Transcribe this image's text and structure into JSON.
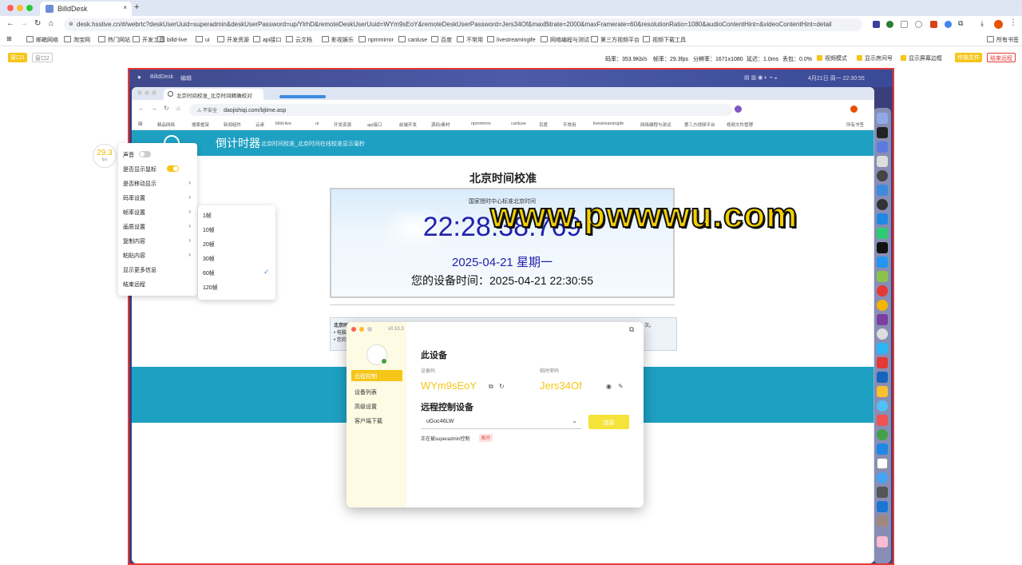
{
  "outer_browser": {
    "tab_title": "BilldDesk",
    "new_tab": "+",
    "url": "desk.hsslive.cn/#/webrtc?deskUserUuid=superadmin&deskUserPassword=up/YlrhD&remoteDeskUserUuid=WYm9sEoY&remoteDeskUserPassword=Jers34Of&maxBitrate=2000&maxFramerate=60&resolutionRatio=1080&audioContentHint=&videoContentHint=detail",
    "bookmarks": [
      "应用",
      "邮箱网络",
      "淘宝网",
      "热门网站",
      "开发工具",
      "billd-live",
      "ui",
      "开发资源",
      "api接口",
      "云文档",
      "影视娱乐",
      "npmmirror",
      "canluse",
      "百度",
      "不常用",
      "livestreamingife",
      "网络编程与测试",
      "第三方视频平台",
      "视频下载工具"
    ],
    "bookmarks_right": "所有书签"
  },
  "control_bar": {
    "btn_window1": "窗口1",
    "btn_window2": "窗口2",
    "stats": [
      "码率：353.9Kb/s",
      "帧率：29.3fps",
      "分辨率：1671x1080",
      "延迟：1.0ms",
      "丢包：0.0%"
    ],
    "options": [
      "视频模式",
      "显示房间号",
      "显示屏幕边框"
    ],
    "btn_file": "传输文件",
    "btn_end": "结束远程"
  },
  "remote": {
    "mac_menu": [
      "BilldDesk",
      "编辑"
    ],
    "mac_status_time": "4月21日 周一 22:30:55",
    "inner_tab": "北京时间校准_北京时间精确校对",
    "inner_url": "daojishiqi.com/bjtime.asp",
    "inner_insecure": "不安全",
    "inner_bookmarks": [
      "精品网络",
      "搜索框架",
      "新闻组件",
      "云桌",
      "billd-live",
      "ui",
      "开发资源",
      "api接口",
      "前端开发",
      "源码/素材",
      "npmmirror",
      "canluse",
      "百度",
      "不常用",
      "livestreamingife",
      "网络编程与测试",
      "第三方视频平台",
      "视频文件管理"
    ],
    "inner_bookmarks_right": "所有书签",
    "site_title": "倒计时器",
    "site_subtitle": "北京时间校准_北京时间在线校准显示毫秒",
    "page_heading": "北京时间校准",
    "clock_label": "国家授时中心标准北京时间",
    "clock_time": "22:28:38.769",
    "clock_date": "2025-04-21 星期一",
    "device_time": "您的设备时间：2025-04-21 22:30:55",
    "info_line1": "北京时间",
    "info_line1_right": "次。",
    "info_bullet1": "• 电脑时",
    "info_bullet2": "• 您的时"
  },
  "fps_badge": {
    "value": "29.3",
    "unit": "fps"
  },
  "menu": {
    "sound": "声音",
    "show_cursor": "是否显示鼠标",
    "video_mode": "是否移动显示",
    "bitrate": "码率设置",
    "framerate": "帧率设置",
    "resolution": "画质设置",
    "copy_content": "复制内容",
    "paste_content": "粘贴内容",
    "show_more": "显示更多信息",
    "end_remote": "结束远程"
  },
  "fps_options": [
    "1帧",
    "10帧",
    "20帧",
    "30帧",
    "60帧",
    "120帧"
  ],
  "fps_selected_index": 4,
  "watermark": "www.pwwwu.com",
  "app": {
    "version": "v0.10.3",
    "nav": [
      "远程控制",
      "设备列表",
      "高级设置",
      "客户端下载"
    ],
    "section_this": "此设备",
    "label_device_id": "设备码",
    "device_id": "WYm9sEoY",
    "label_temp_pw": "临时密码",
    "temp_pw": "Jers34Of",
    "section_remote": "远程控制设备",
    "remote_id": "uGuc46LW",
    "connect_btn": "连接",
    "controlled_by": "正在被superadmin控制",
    "disconnect_badge": "断开"
  },
  "colors": {
    "accent": "#f5c518",
    "header": "#1ea0c3",
    "danger": "#e53935",
    "clock": "#2222aa"
  }
}
